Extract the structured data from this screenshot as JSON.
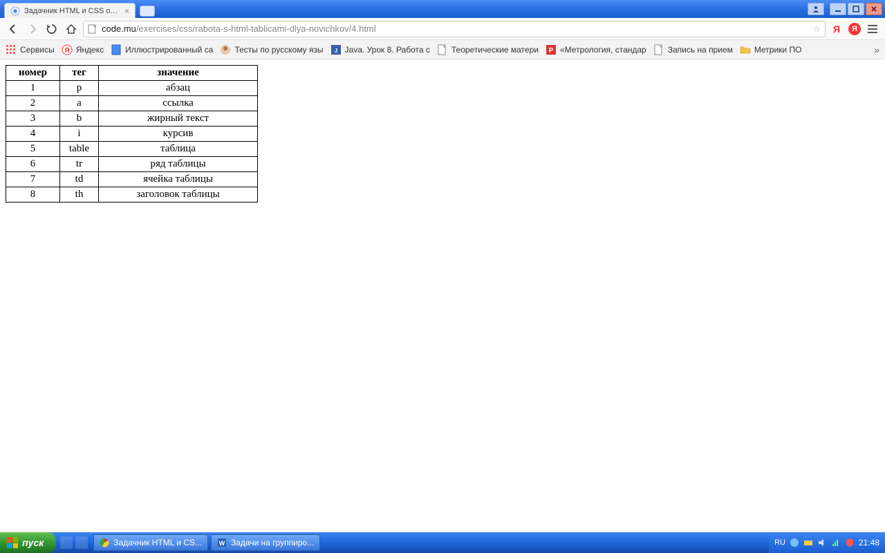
{
  "window": {
    "tab_title": "Задачник HTML и CSS от Тр",
    "url_domain": "code.mu",
    "url_path": "/exercises/css/rabota-s-html-tablicami-dlya-novichkov/4.html"
  },
  "bookmarks": [
    {
      "label": "Сервисы",
      "icon": "apps"
    },
    {
      "label": "Яндекс",
      "icon": "yandex"
    },
    {
      "label": "Иллюстрированный са",
      "icon": "page-blue"
    },
    {
      "label": "Тесты по русскому язы",
      "icon": "avatar"
    },
    {
      "label": "Java. Урок 8. Работа с",
      "icon": "java"
    },
    {
      "label": "Теоретические матери",
      "icon": "page"
    },
    {
      "label": "«Метрология, стандар",
      "icon": "red-p"
    },
    {
      "label": "Запись на прием",
      "icon": "page"
    },
    {
      "label": "Метрики ПО",
      "icon": "folder"
    }
  ],
  "table": {
    "headers": [
      "номер",
      "тег",
      "значение"
    ],
    "rows": [
      [
        "1",
        "p",
        "абзац"
      ],
      [
        "2",
        "a",
        "ссылка"
      ],
      [
        "3",
        "b",
        "жирный текст"
      ],
      [
        "4",
        "i",
        "курсив"
      ],
      [
        "5",
        "table",
        "таблица"
      ],
      [
        "6",
        "tr",
        "ряд таблицы"
      ],
      [
        "7",
        "td",
        "ячейка таблицы"
      ],
      [
        "8",
        "th",
        "заголовок таблицы"
      ]
    ]
  },
  "taskbar": {
    "start": "пуск",
    "tasks": [
      {
        "label": "Задачник HTML и CS...",
        "icon": "chrome"
      },
      {
        "label": "Задачи на группиро...",
        "icon": "word"
      }
    ],
    "lang": "RU",
    "clock": "21:48"
  }
}
